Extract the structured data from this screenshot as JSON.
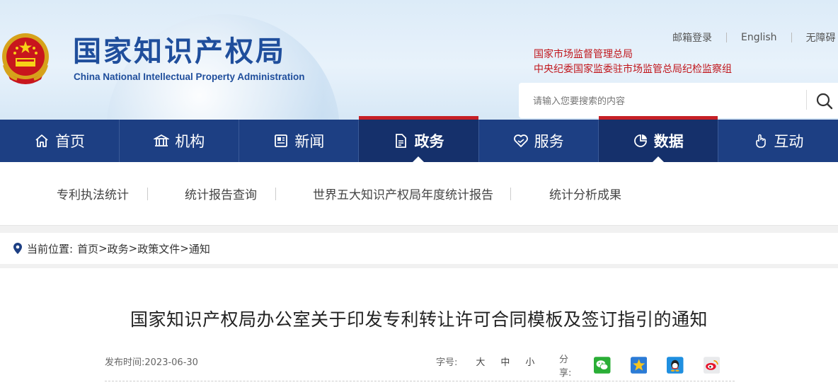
{
  "header": {
    "logo_cn": "国家知识产权局",
    "logo_en": "China National Intellectual Property Administration",
    "top_links": [
      "邮箱登录",
      "English",
      "无障碍"
    ],
    "org_links": [
      "国家市场监督管理总局",
      "中央纪委国家监委驻市场监管总局纪检监察组"
    ],
    "search_placeholder": "请输入您要搜索的内容"
  },
  "nav": {
    "items": [
      {
        "label": "首页",
        "icon": "home-icon"
      },
      {
        "label": "机构",
        "icon": "institution-icon"
      },
      {
        "label": "新闻",
        "icon": "news-icon"
      },
      {
        "label": "政务",
        "icon": "document-icon"
      },
      {
        "label": "服务",
        "icon": "heart-service-icon"
      },
      {
        "label": "数据",
        "icon": "pie-chart-icon"
      },
      {
        "label": "互动",
        "icon": "hand-pointer-icon"
      }
    ],
    "active": [
      "政务",
      "数据"
    ]
  },
  "subnav": [
    "专利执法统计",
    "统计报告查询",
    "世界五大知识产权局年度统计报告",
    "统计分析成果"
  ],
  "breadcrumb": {
    "label": "当前位置:",
    "items": [
      "首页",
      "政务",
      "政策文件",
      "通知"
    ],
    "separator": ">"
  },
  "article": {
    "title": "国家知识产权局办公室关于印发专利转让许可合同模板及签订指引的通知",
    "date_label": "发布时间:",
    "date": "2023-06-30",
    "font_size_label": "字号:",
    "font_sizes": [
      "大",
      "中",
      "小"
    ],
    "share_label": "分享:",
    "share_icons": [
      "wechat-icon",
      "qzone-icon",
      "qq-icon",
      "weibo-icon"
    ]
  },
  "colors": {
    "brand_blue": "#1d3f83",
    "active_red": "#c62026",
    "logo_blue": "#1f4e9c",
    "org_red": "#c0151b"
  }
}
